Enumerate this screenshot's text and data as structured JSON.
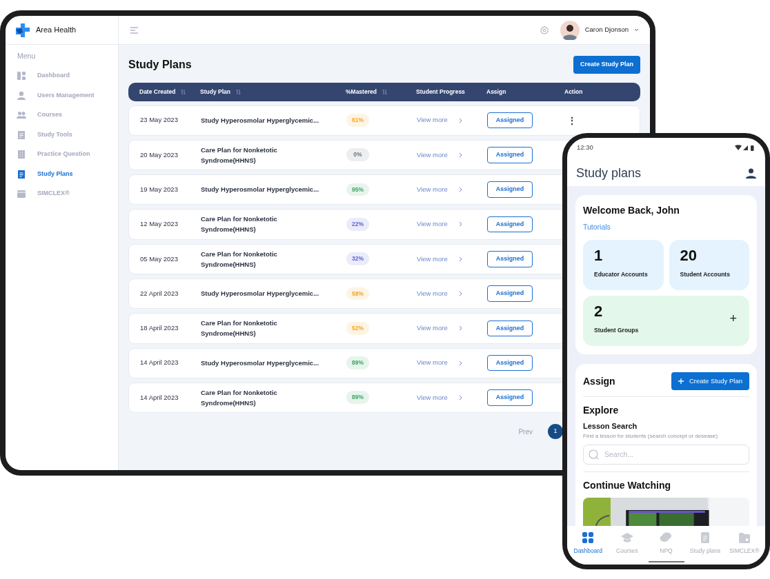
{
  "tablet": {
    "brand": "Area Health",
    "sidebar": {
      "heading": "Menu",
      "items": [
        {
          "label": "Dashboard",
          "selected": false
        },
        {
          "label": "Users Management",
          "selected": false
        },
        {
          "label": "Courses",
          "selected": false
        },
        {
          "label": "Study Tools",
          "selected": false
        },
        {
          "label": "Practice Question",
          "selected": false
        },
        {
          "label": "Study Plans",
          "selected": true
        },
        {
          "label": "SIMCLEX®",
          "selected": false
        }
      ]
    },
    "user": {
      "name": "Caron Djonson"
    },
    "page_title": "Study Plans",
    "create_button": "Create Study Plan",
    "table": {
      "columns": [
        {
          "label": "Date Created",
          "sortable": true
        },
        {
          "label": "Study Plan",
          "sortable": true
        },
        {
          "label": "%Mastered",
          "sortable": true
        },
        {
          "label": "Student Progress",
          "sortable": false
        },
        {
          "label": "Assign",
          "sortable": false
        },
        {
          "label": "Action",
          "sortable": false
        }
      ],
      "rows": [
        {
          "date": "23 May 2023",
          "plan": "Study Hyperosmolar Hyperglycemic...",
          "mastered": "61%",
          "color": "#f5a524",
          "progress": "View more",
          "assign": "Assigned",
          "action": "⋮"
        },
        {
          "date": "20 May 2023",
          "plan": "Care Plan for Nonketotic\nSyndrome(HHNS)",
          "mastered": "0%",
          "color": "#6b7280",
          "progress": "View more",
          "assign": "Assigned"
        },
        {
          "date": "19 May 2023",
          "plan": "Study Hyperosmolar Hyperglycemic...",
          "mastered": "95%",
          "color": "#3aa564",
          "progress": "View more",
          "assign": "Assigned"
        },
        {
          "date": "12 May 2023",
          "plan": "Care Plan for Nonketotic\nSyndrome(HHNS)",
          "mastered": "22%",
          "color": "#5b63d3",
          "progress": "View more",
          "assign": "Assigned"
        },
        {
          "date": "05 May 2023",
          "plan": "Care Plan for Nonketotic\nSyndrome(HHNS)",
          "mastered": "32%",
          "color": "#5b63d3",
          "progress": "View more",
          "assign": "Assigned"
        },
        {
          "date": "22 April 2023",
          "plan": "Study Hyperosmolar Hyperglycemic...",
          "mastered": "58%",
          "color": "#f5a524",
          "progress": "View more",
          "assign": "Assigned"
        },
        {
          "date": "18 April 2023",
          "plan": "Care Plan for Nonketotic\nSyndrome(HHNS)",
          "mastered": "52%",
          "color": "#f5a524",
          "progress": "View more",
          "assign": "Assigned"
        },
        {
          "date": "14 April 2023",
          "plan": "Study Hyperosmolar Hyperglycemic...",
          "mastered": "89%",
          "color": "#3aa564",
          "progress": "View more",
          "assign": "Assigned"
        },
        {
          "date": "14 April 2023",
          "plan": "Care Plan for Nonketotic\nSyndrome(HHNS)",
          "mastered": "89%",
          "color": "#3aa564",
          "progress": "View more",
          "assign": "Assigned"
        }
      ]
    },
    "pagination": {
      "prev": "Prev",
      "pages": [
        {
          "label": "1",
          "selected": true
        }
      ]
    }
  },
  "phone": {
    "time": "12:30",
    "title": "Study plans",
    "welcome": "Welcome Back, John",
    "tutorials": "Tutorials",
    "stats": [
      {
        "value": "1",
        "label": "Educator Accounts",
        "kind": "account"
      },
      {
        "value": "20",
        "label": "Student Accounts",
        "kind": "account"
      },
      {
        "value": "2",
        "label": "Student Groups",
        "kind": "group",
        "action": "+"
      }
    ],
    "assign": {
      "title": "Assign",
      "button": "Create Study Plan"
    },
    "explore": {
      "title": "Explore",
      "search_title": "Lesson Search",
      "hint": "Find a lesson for students (search concept or desease)",
      "placeholder": "Search..."
    },
    "continue_title": "Continue Watching",
    "nav": [
      {
        "label": "Dashboard",
        "selected": true
      },
      {
        "label": "Courses",
        "selected": false
      },
      {
        "label": "NPQ",
        "selected": false
      },
      {
        "label": "Study plans",
        "selected": false
      },
      {
        "label": "SIMCLEX®",
        "selected": false
      }
    ]
  }
}
